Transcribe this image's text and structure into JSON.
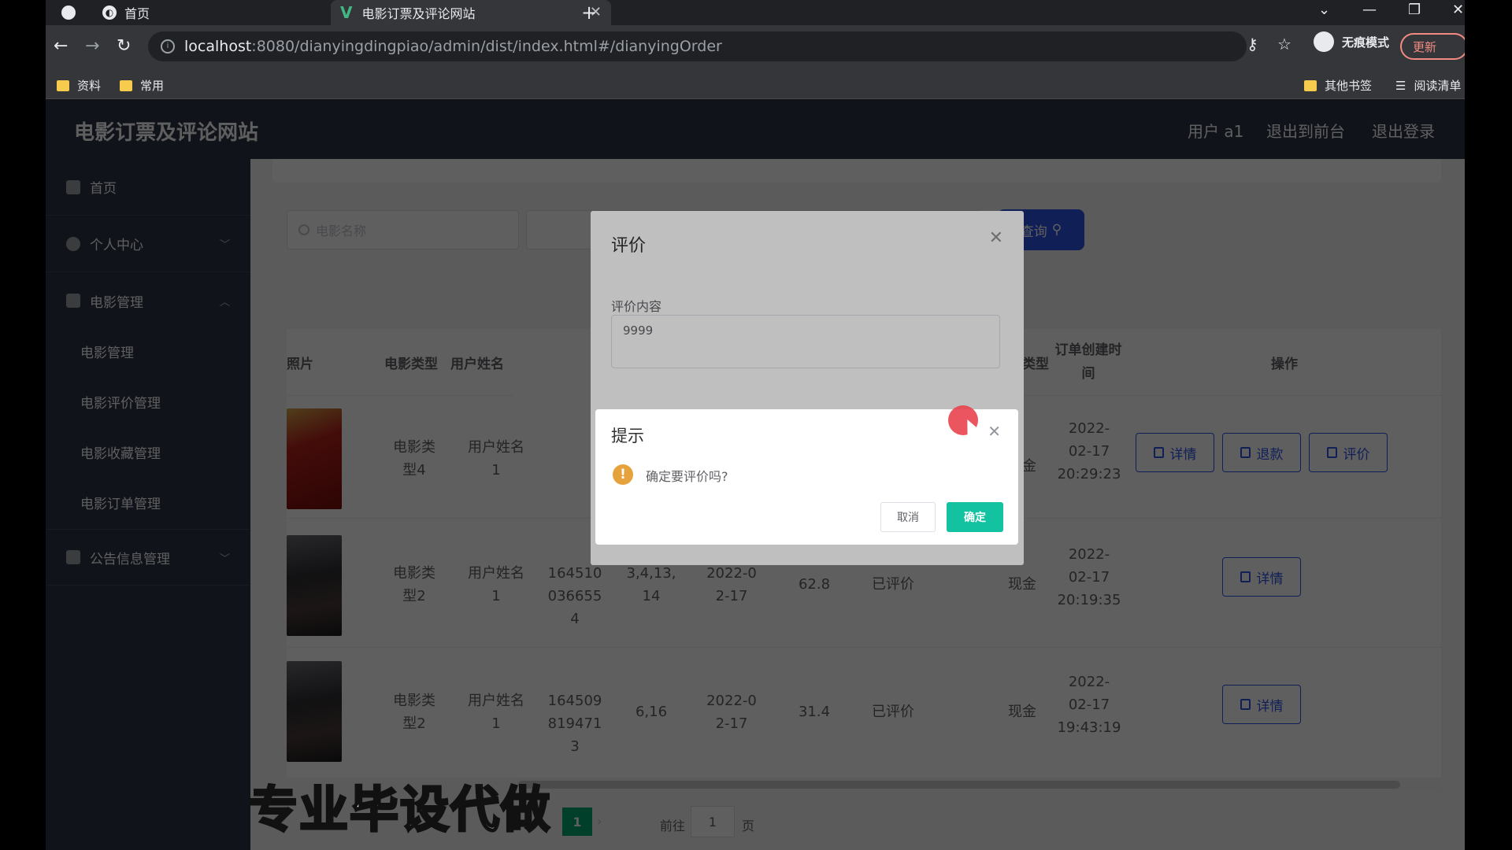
{
  "browser": {
    "tabs": [
      {
        "label": "首页"
      },
      {
        "label": "电影订票及评论网站"
      }
    ],
    "url_host": "localhost",
    "url_rest": ":8080/dianyingdingpiao/admin/dist/index.html#/dianyingOrder",
    "incognito_label": "无痕模式",
    "update_label": "更新",
    "bookmarks": [
      "资料",
      "常用"
    ],
    "bookmarks_right": [
      "其他书签",
      "阅读清单"
    ]
  },
  "header": {
    "title": "电影订票及评论网站",
    "user": "用户 a1",
    "back_front": "退出到前台",
    "logout": "退出登录"
  },
  "sidebar": {
    "items": [
      {
        "label": "首页",
        "icon": "home-icon"
      },
      {
        "label": "个人中心",
        "icon": "user-icon"
      },
      {
        "label": "电影管理",
        "icon": "flag-icon"
      },
      {
        "label": "公告信息管理",
        "icon": "bell-icon"
      }
    ],
    "sub_items": [
      "电影管理",
      "电影评价管理",
      "电影收藏管理",
      "电影订单管理"
    ]
  },
  "search": {
    "placeholder": "电影名称",
    "query_label": "查询"
  },
  "table": {
    "headers": [
      "照片",
      "电影类型",
      "用户姓名",
      "支付类型",
      "订单创建时间",
      "操作"
    ],
    "rows": [
      {
        "type": "电影类型4",
        "user": "用户姓名1",
        "pay": "现金",
        "created": "2022-02-17 20:29:23",
        "actions": [
          "详情",
          "退款",
          "评价"
        ]
      },
      {
        "type": "电影类型2",
        "user": "用户姓名1",
        "order_no": "1645100366554",
        "seats": "3,4,13,14",
        "date": "2022-02-17",
        "price": "62.8",
        "status": "已评价",
        "pay": "现金",
        "created": "2022-02-17 20:19:35",
        "actions": [
          "详情"
        ]
      },
      {
        "type": "电影类型2",
        "user": "用户姓名1",
        "order_no": "1645098194713",
        "seats": "6,16",
        "date": "2022-02-17",
        "price": "31.4",
        "status": "已评价",
        "pay": "现金",
        "created": "2022-02-17 19:43:19",
        "actions": [
          "详情"
        ]
      }
    ]
  },
  "pagination": {
    "current": "1",
    "goto_prefix": "前往",
    "goto_value": "1",
    "goto_suffix": "页"
  },
  "review_dialog": {
    "title": "评价",
    "field_label": "评价内容",
    "field_value": "9999"
  },
  "confirm_dialog": {
    "title": "提示",
    "message": "确定要评价吗?",
    "cancel": "取消",
    "ok": "确定"
  },
  "watermark": "专业毕设代做"
}
